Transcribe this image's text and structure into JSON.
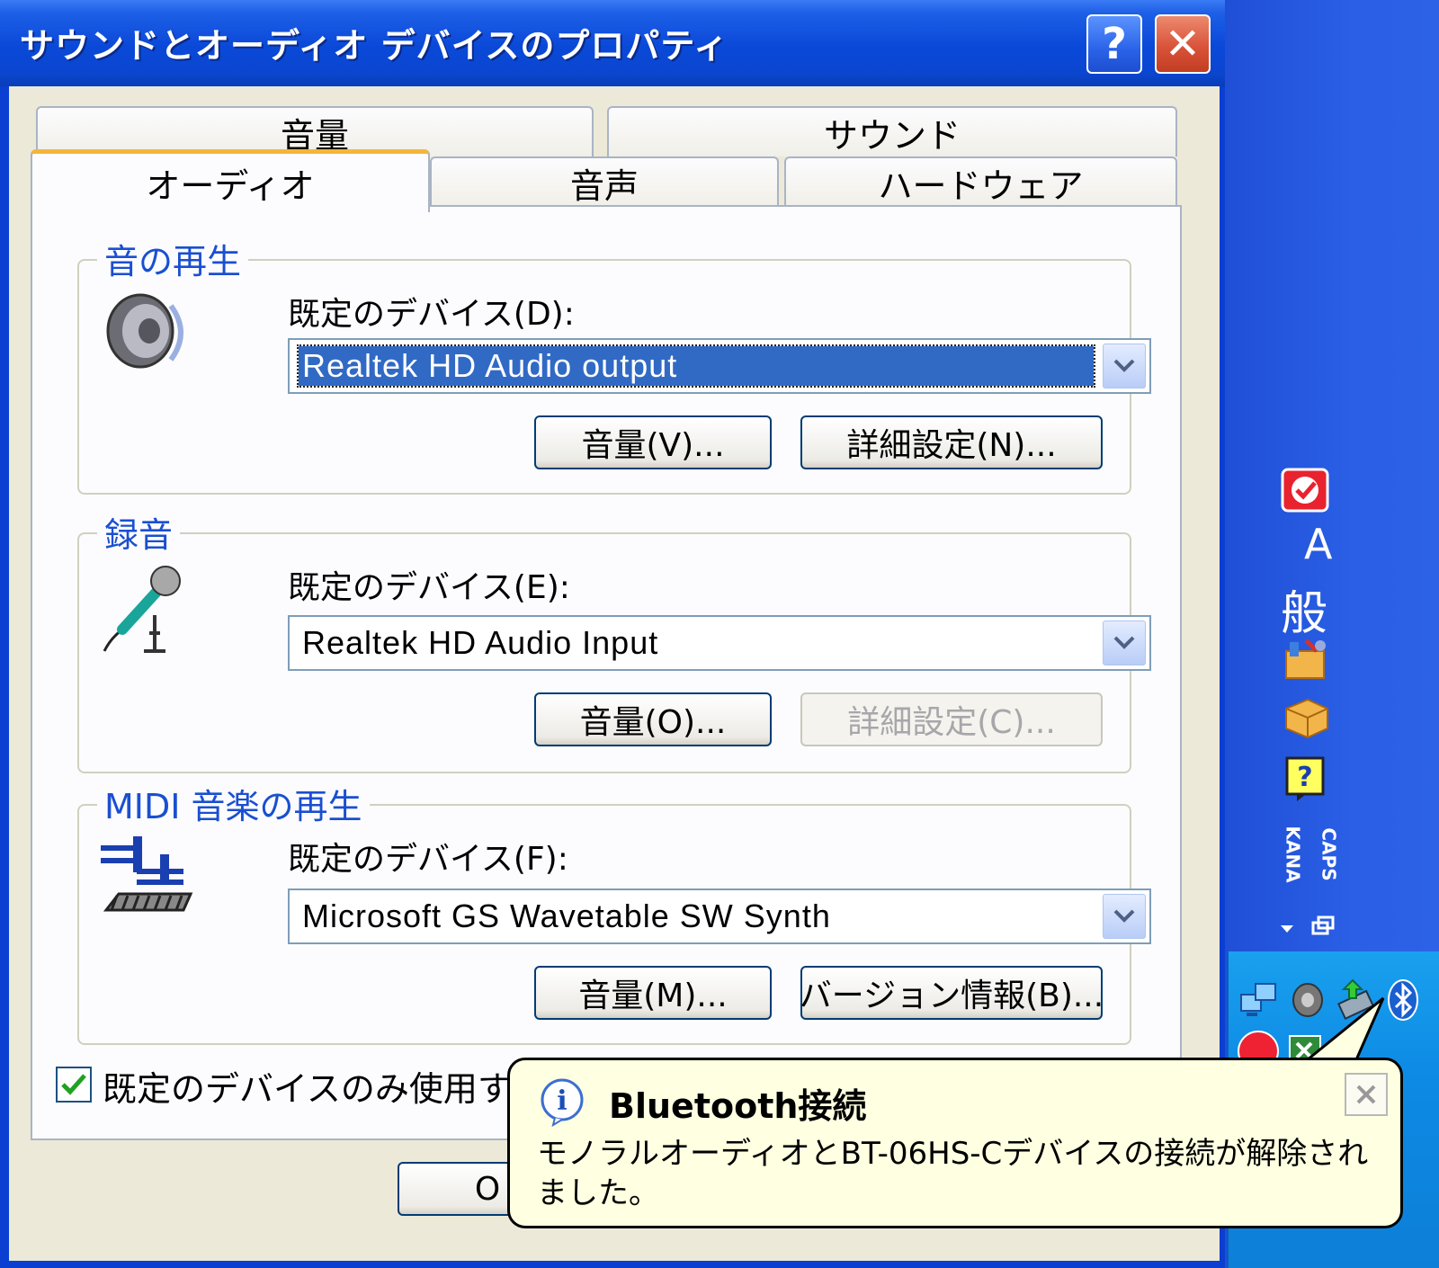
{
  "window": {
    "title": "サウンドとオーディオ デバイスのプロパティ",
    "help_button": "?",
    "close_button": "✕"
  },
  "tabs": {
    "row_back": [
      {
        "label": "音量"
      },
      {
        "label": "サウンド"
      }
    ],
    "row_front": [
      {
        "label": "オーディオ",
        "active": true
      },
      {
        "label": "音声"
      },
      {
        "label": "ハードウェア"
      }
    ]
  },
  "playback": {
    "title": "音の再生",
    "device_label": "既定のデバイス(D):",
    "device_value": "Realtek HD Audio output",
    "volume_button": "音量(V)...",
    "advanced_button": "詳細設定(N)..."
  },
  "recording": {
    "title": "録音",
    "device_label": "既定のデバイス(E):",
    "device_value": "Realtek HD Audio Input",
    "volume_button": "音量(O)...",
    "advanced_button": "詳細設定(C)..."
  },
  "midi": {
    "title": "MIDI 音楽の再生",
    "device_label": "既定のデバイス(F):",
    "device_value": "Microsoft GS Wavetable SW Synth",
    "volume_button": "音量(M)...",
    "about_button": "バージョン情報(B)..."
  },
  "use_default_only": {
    "label": "既定のデバイスのみ使用する",
    "checked": true
  },
  "ok_button": "O",
  "balloon": {
    "title": "Bluetooth接続",
    "message": "モノラルオーディオとBT-06HS-Cデバイスの接続が解除されました。"
  },
  "language_bar": {
    "input_mode": "A",
    "conversion_mode": "般",
    "kana_label": "KANA",
    "caps_label": "CAPS"
  },
  "colors": {
    "title_bar": "#0a48d8",
    "group_title": "#1a4fd0",
    "selection": "#316ac5",
    "active_tab_accent": "#f5b53b",
    "balloon_bg": "#ffffe1",
    "taskbar_tray": "#0d8ae4"
  }
}
